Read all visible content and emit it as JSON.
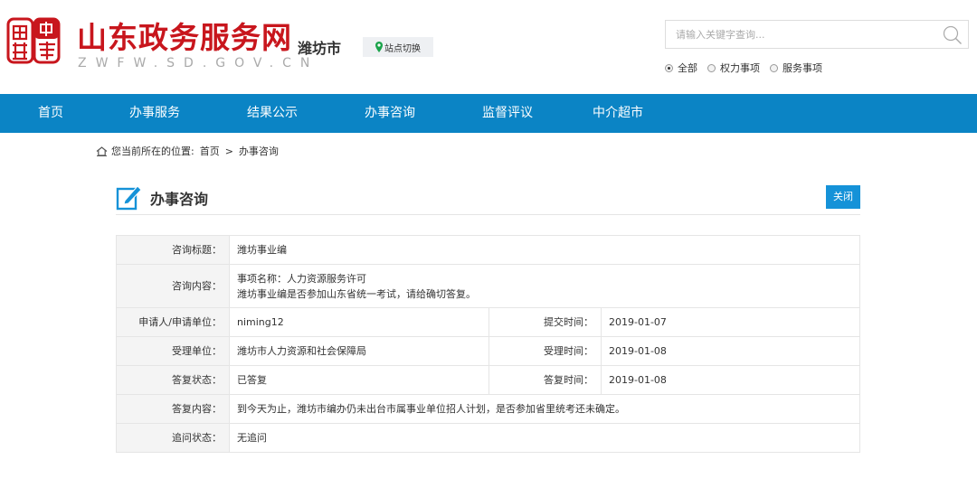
{
  "header": {
    "site_title": "山东政务服务网",
    "site_url": "ZWFW.SD.GOV.CN",
    "city": "潍坊市",
    "switch_label": "站点切换",
    "search_placeholder": "请输入关键字查询...",
    "scope_options": [
      {
        "label": "全部",
        "selected": true
      },
      {
        "label": "权力事项",
        "selected": false
      },
      {
        "label": "服务事项",
        "selected": false
      }
    ]
  },
  "nav": {
    "items": [
      "首页",
      "办事服务",
      "结果公示",
      "办事咨询",
      "监督评议",
      "中介超市"
    ]
  },
  "breadcrumb": {
    "prefix": "您当前所在的位置:",
    "items": [
      "首页",
      "办事咨询"
    ],
    "separator": ">"
  },
  "section": {
    "title": "办事咨询",
    "close_label": "关闭"
  },
  "detail": {
    "title_label": "咨询标题：",
    "title_value": "潍坊事业编",
    "content_label": "咨询内容：",
    "content_line1": "事项名称：人力资源服务许可",
    "content_line2": "潍坊事业编是否参加山东省统一考试，请给确切答复。",
    "applicant_label": "申请人/申请单位：",
    "applicant_value": "niming12",
    "submit_time_label": "提交时间：",
    "submit_time_value": "2019-01-07",
    "handler_label": "受理单位：",
    "handler_value": "潍坊市人力资源和社会保障局",
    "accept_time_label": "受理时间：",
    "accept_time_value": "2019-01-08",
    "reply_status_label": "答复状态：",
    "reply_status_value": "已答复",
    "reply_time_label": "答复时间：",
    "reply_time_value": "2019-01-08",
    "reply_content_label": "答复内容：",
    "reply_content_value": "到今天为止，潍坊市编办仍未出台市属事业单位招人计划，是否参加省里统考还未确定。",
    "followup_label": "追问状态：",
    "followup_value": "无追问"
  },
  "colors": {
    "brand_red": "#c8161d",
    "nav_blue": "#0b84c5",
    "button_blue": "#1592d8"
  },
  "icons": [
    "logo-seal",
    "location-pin-icon",
    "search-icon",
    "home-icon",
    "edit-icon"
  ]
}
